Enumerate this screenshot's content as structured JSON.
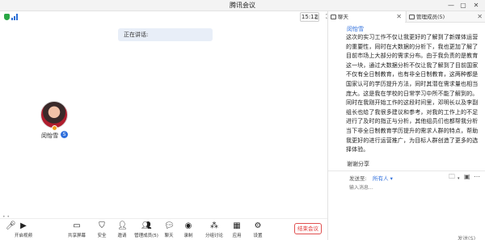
{
  "window": {
    "title": "腾讯会议",
    "min_glyph": "—",
    "max_glyph": "▢",
    "close_glyph": "✕"
  },
  "infobar": {
    "duration": "15:12",
    "speaking_label": "正在讲话:"
  },
  "participant": {
    "name": "闵怡雪",
    "status_glyph": "S"
  },
  "toolbar": {
    "items": [
      {
        "id": "mute",
        "label": "",
        "icon": "microphone-icon",
        "glyph": "🎤︎"
      },
      {
        "id": "video",
        "label": "开启视频",
        "icon": "video-camera-off-icon",
        "glyph": "▶"
      },
      {
        "id": "share",
        "label": "共享屏幕",
        "icon": "share-screen-icon",
        "glyph": "▭"
      },
      {
        "id": "security",
        "label": "安全",
        "icon": "shield-icon",
        "glyph": "⛉"
      },
      {
        "id": "invite",
        "label": "邀请",
        "icon": "invite-icon",
        "glyph": "👤︎"
      },
      {
        "id": "members",
        "label": "管理成员(5)",
        "icon": "members-icon",
        "glyph": "👥︎"
      },
      {
        "id": "chat",
        "label": "聊天",
        "icon": "chat-icon",
        "glyph": "💬︎"
      },
      {
        "id": "record",
        "label": "录制",
        "icon": "record-icon",
        "glyph": "◉"
      },
      {
        "id": "breakout",
        "label": "分组讨论",
        "icon": "breakout-icon",
        "glyph": "⁂"
      },
      {
        "id": "apps",
        "label": "应用",
        "icon": "apps-icon",
        "glyph": "▦"
      },
      {
        "id": "settings",
        "label": "设置",
        "icon": "gear-icon",
        "glyph": "⚙"
      }
    ],
    "end_label": "结束会议"
  },
  "panel": {
    "tab_chat": "聊天",
    "tab_members": "管理成员(5)",
    "message_sender": "闵怡雪",
    "message_text": "这次的实习工作不仅让我更好的了解到了新媒体运营的重要性，同时在大数据的分析下，我也更加了解了目前市场上大部分的需求分布。由于我负责的是教育这一块，通过大数据分析不仅让我了解到了目前国家不仅有全日制教育，也有非全日制教育，这两种都是国家认可的学历提升方法，同时其潜在需求量也相当庞大。这是我在学校的日常学习中所不能了解到的。同时在我刚开始工作的这段时间里，邓明长以及李副组长也给了我很多建议和参考，对我的工作上的不足进行了及时的指正与分析，其他组员们也都帮我分析当下非全日制教育学历提升的需求人群的特点，帮助我更好的进行运营推广，为目标人群创造了更多的选择体验。",
    "share_line": "谢谢分享",
    "sendto_label": "发送至:",
    "sendto_value": "所有人 ▾",
    "input_placeholder": "输入消息...",
    "send_label": "发送(S)"
  },
  "colors": {
    "accent": "#2f6fdc",
    "end_red": "#e03030",
    "speaking_bg": "#e8eef8"
  }
}
